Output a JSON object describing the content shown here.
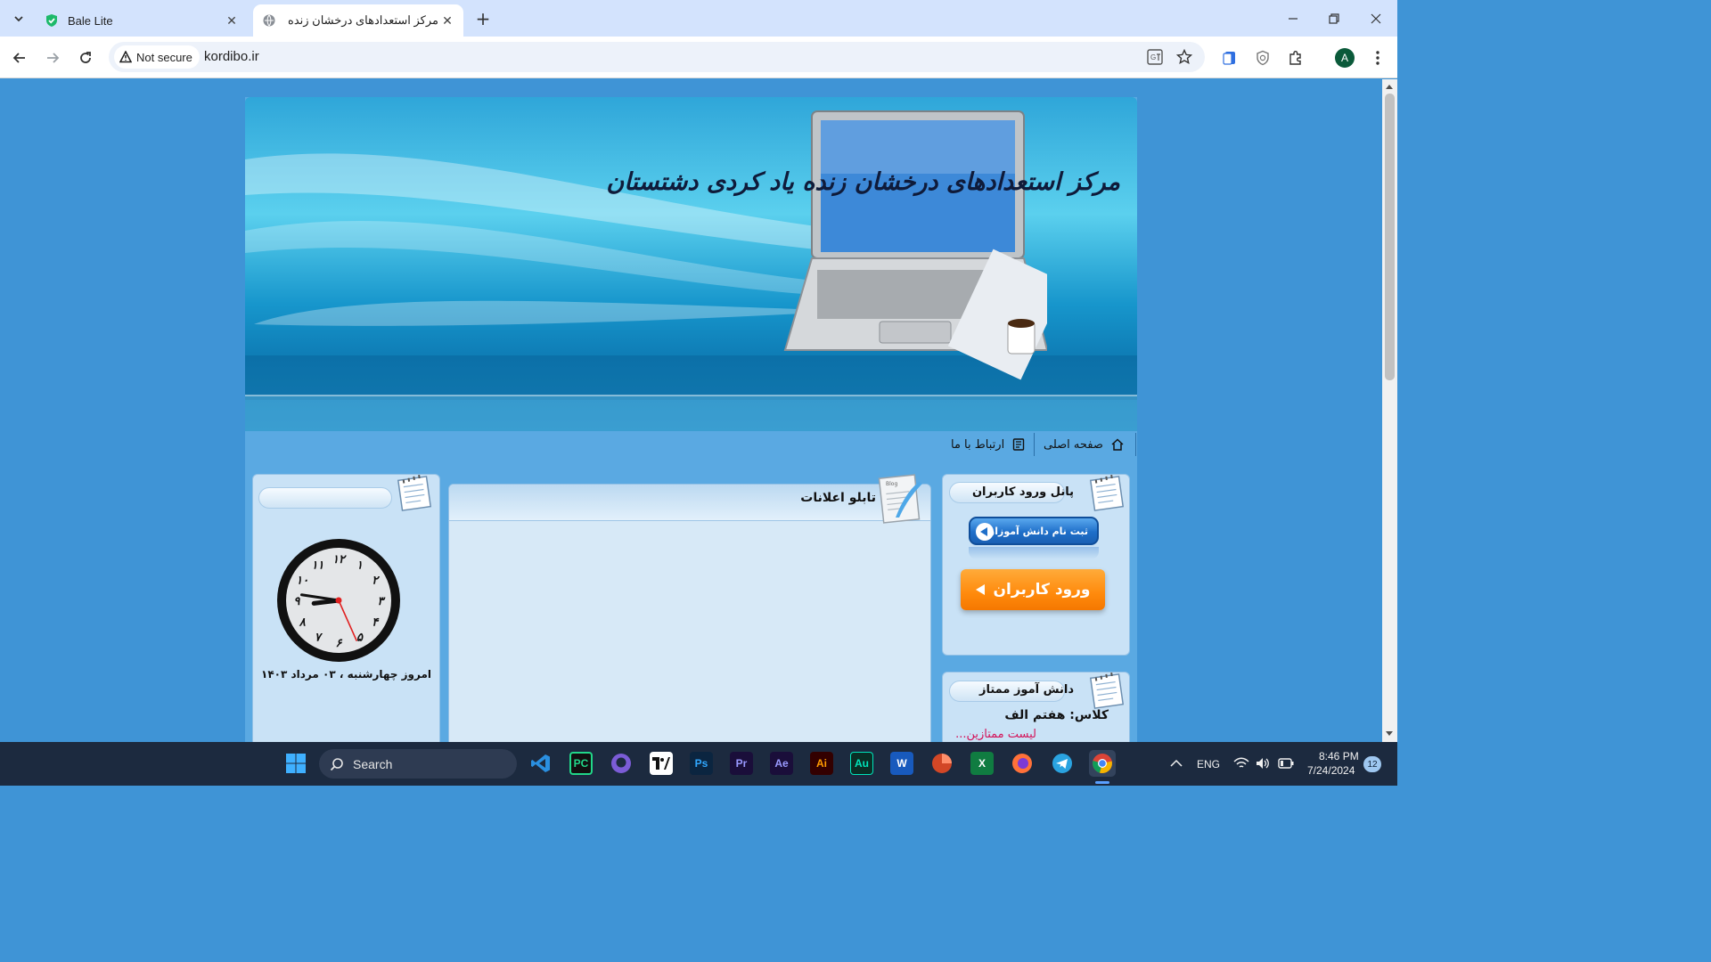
{
  "browser": {
    "tabs": [
      {
        "title": "Bale Lite",
        "active": false
      },
      {
        "title": "مرکز استعدادهای درخشان زنده یاد",
        "active": true
      }
    ],
    "security_label": "Not secure",
    "url": "kordibo.ir",
    "profile_initial": "A"
  },
  "site": {
    "banner_title": "مرکز استعدادهای درخشان زنده یاد کردی دشتستان",
    "menu": {
      "home": "صفحه اصلی",
      "contact": "ارتباط با ما"
    },
    "login_panel": {
      "title": "پانل ورود کاربران",
      "register_button": "ثبت نام دانش آموزان",
      "login_button": "ورود کاربران"
    },
    "notice_board": {
      "title": "تابلو اعلانات",
      "icon_caption": "Blog"
    },
    "top_student": {
      "title": "دانش آموز ممتاز",
      "class_line": "کلاس: هفتم الف",
      "list_link": "لیست ممتازین..."
    },
    "clock_box": {
      "title": "",
      "time": {
        "hour": 8,
        "minute": 46,
        "second": 26
      },
      "numerals": [
        "۱۲",
        "۱",
        "۲",
        "۳",
        "۴",
        "۵",
        "۶",
        "۷",
        "۸",
        "۹",
        "۱۰",
        "۱۱"
      ],
      "date_text": "امروز چهارشنبه ، ۰۳ مرداد ۱۴۰۳"
    }
  },
  "taskbar": {
    "search_placeholder": "Search",
    "apps": [
      "vscode-icon",
      "pycharm-icon",
      "github-icon",
      "tradingview-icon",
      "photoshop-icon",
      "premiere-icon",
      "after-effects-icon",
      "illustrator-icon",
      "audition-icon",
      "word-icon",
      "powerpoint-icon",
      "excel-icon",
      "firefox-icon",
      "telegram-icon",
      "chrome-icon"
    ],
    "app_labels": {
      "pycharm": "PC",
      "photoshop": "Ps",
      "premiere": "Pr",
      "after_effects": "Ae",
      "illustrator": "Ai",
      "audition": "Au",
      "word": "W",
      "excel": "X"
    },
    "language": "ENG",
    "time": "8:46 PM",
    "date": "7/24/2024",
    "notification_count": "12"
  }
}
